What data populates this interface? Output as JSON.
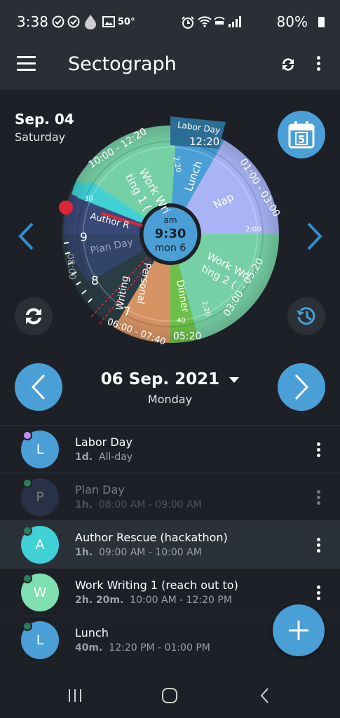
{
  "status": {
    "time": "3:38",
    "temp": "50°",
    "battery": "80%",
    "icons": [
      "check-circle-icon",
      "check-circle-icon",
      "drop-icon",
      "image-icon",
      "alarm-icon",
      "wifi-icon",
      "volte-icon",
      "signal-icon",
      "battery-icon"
    ]
  },
  "appbar": {
    "title": "Sectograph"
  },
  "header": {
    "date": "Sep. 04",
    "day": "Saturday",
    "calendar_day": "5"
  },
  "dial": {
    "center_ampm": "am",
    "center_time": "9:30",
    "center_date": "mon 6",
    "labor_day": "Labor Day",
    "sectors": [
      {
        "label": "Work Wri",
        "label2": "ting 1 (",
        "range": "10:00 - 12:20",
        "color": "#7ee0b0"
      },
      {
        "label": "Lunch",
        "range": "12:20",
        "sub": "2:20",
        "color": "#4a9fd6"
      },
      {
        "label": "Nap",
        "range": "01:00 - 03:00",
        "sub": "2:00",
        "color": "#a9b4f7"
      },
      {
        "label": "Work Wri",
        "label2": "ting 2 (",
        "range": "03:00 - 05:20",
        "sub": "2:20",
        "color": "#7ee0b0"
      },
      {
        "label": "Dinner",
        "range": "05:20",
        "sub": "40",
        "color": "#6cc04a"
      },
      {
        "label": "Personal",
        "label2": "Writing",
        "range": "06:00 - 07:40",
        "color": "#f4a36a"
      },
      {
        "label": "Plan Day",
        "color": "#3a4a7a"
      },
      {
        "label": "Author R",
        "sub": "30",
        "color": "#3fd1d6"
      }
    ],
    "hours": [
      "9",
      "8",
      "7"
    ],
    "ring_text": "08:00"
  },
  "selected": {
    "date": "06 Sep. 2021",
    "dow": "Monday"
  },
  "events": [
    {
      "letter": "L",
      "title": "Labor Day",
      "duration": "1d.",
      "time": "All-day",
      "color": "#4a9fd6",
      "dot": "#c68cf5",
      "dim": false,
      "selected": false
    },
    {
      "letter": "P",
      "title": "Plan Day",
      "duration": "1h.",
      "time": "08:00 AM  -  09:00 AM",
      "color": "#3a4a7a",
      "dot": "#2e7d5a",
      "dim": true,
      "selected": false
    },
    {
      "letter": "A",
      "title": "Author Rescue (hackathon)",
      "duration": "1h.",
      "time": "09:00 AM  -  10:00 AM",
      "color": "#3fd1d6",
      "dot": "#2e7d5a",
      "dim": false,
      "selected": true
    },
    {
      "letter": "W",
      "title": "Work Writing 1 (reach out to)",
      "duration": "2h. 20m.",
      "time": "10:00 AM  -  12:20 PM",
      "color": "#7ee0b0",
      "dot": "#2e7d5a",
      "dim": false,
      "selected": false
    },
    {
      "letter": "L",
      "title": "Lunch",
      "duration": "40m.",
      "time": "12:20 PM  -  01:00 PM",
      "color": "#4a9fd6",
      "dot": "#2e7d5a",
      "dim": false,
      "selected": false
    }
  ],
  "colors": {
    "accent": "#4a9fd6",
    "background": "#1d2127",
    "bar": "#2a2f36"
  }
}
